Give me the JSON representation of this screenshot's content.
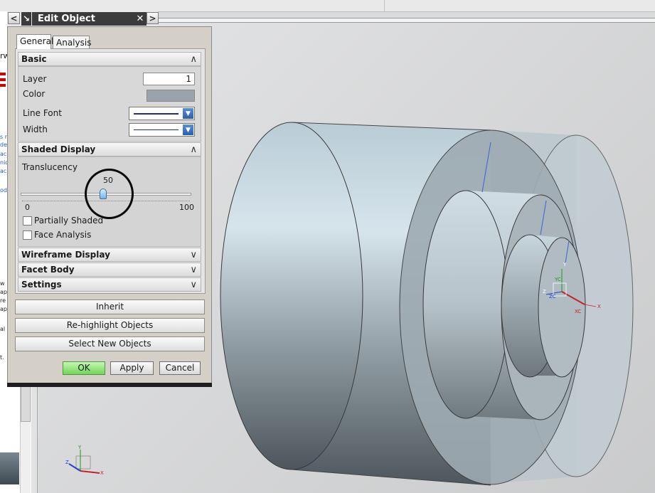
{
  "dialog": {
    "title": "Edit Object Display",
    "tabs": [
      {
        "label": "General",
        "active": true
      },
      {
        "label": "Analysis",
        "active": false
      }
    ],
    "sections": {
      "basic": {
        "title": "Basic",
        "layer_label": "Layer",
        "layer_value": "1",
        "color_label": "Color",
        "color_value": "#98a3ab",
        "line_font_label": "Line Font",
        "width_label": "Width"
      },
      "shaded": {
        "title": "Shaded Display",
        "translucency_label": "Translucency",
        "translucency_value": "50",
        "slider_min": "0",
        "slider_max": "100",
        "partially_shaded_label": "Partially Shaded",
        "partially_shaded_checked": false,
        "face_analysis_label": "Face Analysis",
        "face_analysis_checked": false
      },
      "collapsed": [
        {
          "title": "Wireframe Display"
        },
        {
          "title": "Facet Body"
        },
        {
          "title": "Settings"
        }
      ]
    },
    "buttons": {
      "inherit": "Inherit",
      "rehighlight": "Re-highlight Objects",
      "select_new": "Select New Objects",
      "ok": "OK",
      "apply": "Apply",
      "cancel": "Cancel"
    }
  },
  "viewport": {
    "wcs_axes": {
      "x": "X",
      "y": "Y",
      "z": "Z",
      "xc": "XC",
      "yc": "YC",
      "zc": "ZC"
    }
  },
  "colors": {
    "ok_button": "#7ad85f",
    "body_color": "#98a3ab",
    "annotation_circle": "#0a0a0a"
  }
}
